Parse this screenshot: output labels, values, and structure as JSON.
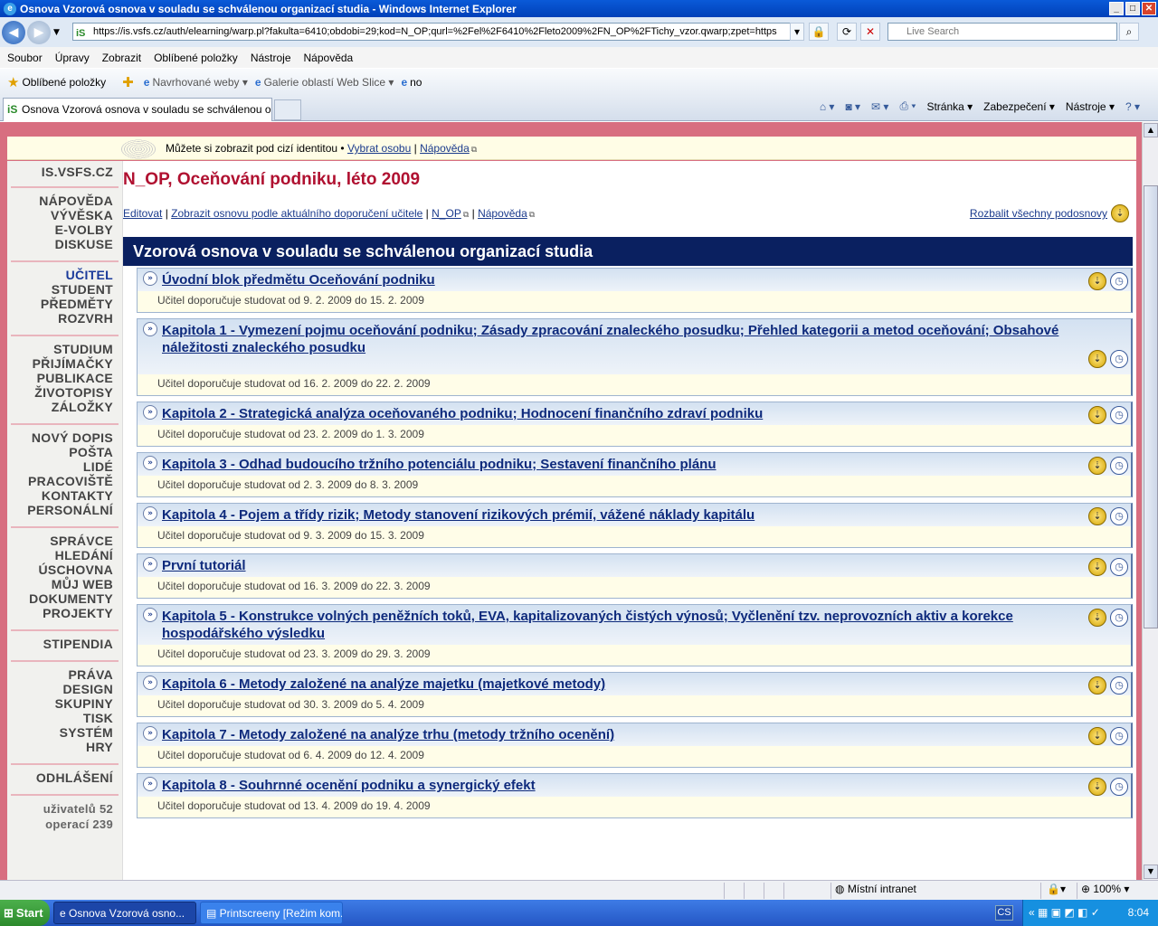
{
  "window": {
    "title": "Osnova Vzorová osnova v souladu se schválenou organizací studia - Windows Internet Explorer"
  },
  "address": {
    "url": "https://is.vsfs.cz/auth/elearning/warp.pl?fakulta=6410;obdobi=29;kod=N_OP;qurl=%2Fel%2F6410%2Fleto2009%2FN_OP%2FTichy_vzor.qwarp;zpet=https",
    "search_placeholder": "Live Search"
  },
  "menu": [
    "Soubor",
    "Úpravy",
    "Zobrazit",
    "Oblíbené položky",
    "Nástroje",
    "Nápověda"
  ],
  "favbar": {
    "favorites": "Oblíbené položky",
    "suggested": "Navrhované weby ▾",
    "gallery": "Galerie oblastí Web Slice ▾",
    "no": "no"
  },
  "tab": {
    "title": "Osnova Vzorová osnova v souladu se schválenou org..."
  },
  "cmdbar": {
    "page": "Stránka ▾",
    "safety": "Zabezpečení ▾",
    "tools": "Nástroje ▾"
  },
  "identity": {
    "text": "Můžete si zobrazit pod cizí identitou •",
    "choose": "Vybrat osobu",
    "sep": "|",
    "help": "Nápověda"
  },
  "sidebar": {
    "groups": [
      {
        "items": [
          "IS.VSFS.CZ"
        ]
      },
      {
        "items": [
          "NÁPOVĚDA",
          "VÝVĚSKA",
          "E-VOLBY",
          "DISKUSE"
        ]
      },
      {
        "items": [
          "UČITEL",
          "STUDENT",
          "PŘEDMĚTY",
          "ROZVRH"
        ]
      },
      {
        "items": [
          "STUDIUM",
          "PŘIJÍMAČKY",
          "PUBLIKACE",
          "ŽIVOTOPISY",
          "ZÁLOŽKY"
        ]
      },
      {
        "items": [
          "NOVÝ DOPIS",
          "POŠTA",
          "LIDÉ",
          "PRACOVIŠTĚ",
          "KONTAKTY",
          "PERSONÁLNÍ"
        ]
      },
      {
        "items": [
          "SPRÁVCE",
          "HLEDÁNÍ",
          "ÚSCHOVNA",
          "MŮJ WEB",
          "DOKUMENTY",
          "PROJEKTY"
        ]
      },
      {
        "items": [
          "STIPENDIA"
        ]
      },
      {
        "items": [
          "PRÁVA",
          "DESIGN",
          "SKUPINY",
          "TISK",
          "SYSTÉM",
          "HRY"
        ]
      },
      {
        "items": [
          "ODHLÁŠENÍ"
        ]
      }
    ],
    "stats": [
      "uživatelů 52",
      "operací 239"
    ]
  },
  "course": {
    "title": "N_OP, Oceňování podniku, léto 2009"
  },
  "links": {
    "edit": "Editovat",
    "show": "Zobrazit osnovu podle aktuálního doporučení učitele",
    "nop": "N_OP",
    "help": "Nápověda",
    "expand": "Rozbalit všechny podosnovy"
  },
  "banner": "Vzorová osnova v souladu se schválenou organizací studia",
  "chapters": [
    {
      "title": "Úvodní blok předmětu Oceňování podniku",
      "date": "Učitel doporučuje studovat od 9. 2. 2009 do 15. 2. 2009"
    },
    {
      "title": "Kapitola 1 - Vymezení pojmu oceňování podniku; Zásady zpracování znaleckého posudku; Přehled kategorii a metod oceňování; Obsahové náležitosti znaleckého posudku",
      "date": "Učitel doporučuje studovat od 16. 2. 2009 do 22. 2. 2009"
    },
    {
      "title": "Kapitola 2 - Strategická analýza oceňovaného podniku; Hodnocení finančního zdraví podniku",
      "date": "Učitel doporučuje studovat od 23. 2. 2009 do 1. 3. 2009"
    },
    {
      "title": "Kapitola 3 - Odhad budoucího tržního potenciálu podniku; Sestavení finančního plánu",
      "date": "Učitel doporučuje studovat od 2. 3. 2009 do 8. 3. 2009"
    },
    {
      "title": "Kapitola 4 - Pojem a třídy rizik; Metody stanovení rizikových prémií, vážené náklady kapitálu",
      "date": "Učitel doporučuje studovat od 9. 3. 2009 do 15. 3. 2009"
    },
    {
      "title": "První tutoriál",
      "date": "Učitel doporučuje studovat od 16. 3. 2009 do 22. 3. 2009"
    },
    {
      "title": "Kapitola 5 - Konstrukce volných peněžních toků, EVA, kapitalizovaných čistých výnosů; Vyčlenění tzv. neprovozních aktiv a korekce hospodářského výsledku",
      "date": "Učitel doporučuje studovat od 23. 3. 2009 do 29. 3. 2009"
    },
    {
      "title": "Kapitola 6 - Metody založené na analýze majetku (majetkové metody)",
      "date": "Učitel doporučuje studovat od 30. 3. 2009 do 5. 4. 2009"
    },
    {
      "title": "Kapitola 7 - Metody založené na analýze trhu (metody tržního ocenění)",
      "date": "Učitel doporučuje studovat od 6. 4. 2009 do 12. 4. 2009"
    },
    {
      "title": "Kapitola 8 - Souhrnné ocenění podniku a synergický efekt",
      "date": "Učitel doporučuje studovat od 13. 4. 2009 do 19. 4. 2009"
    }
  ],
  "status": {
    "zone": "Místní intranet",
    "zoom": "100%"
  },
  "taskbar": {
    "start": "Start",
    "task1": "Osnova Vzorová osno...",
    "task2": "Printscreeny [Režim kom...",
    "lang": "CS",
    "clock": "8:04"
  }
}
